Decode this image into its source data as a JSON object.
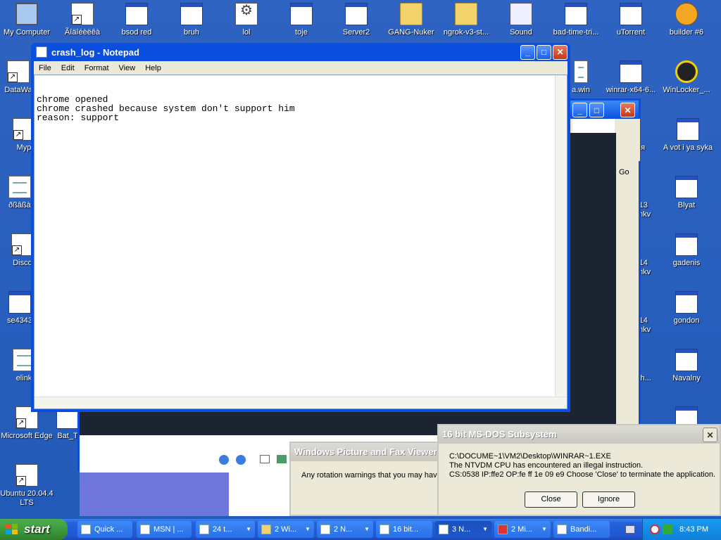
{
  "desktop_icons": [
    {
      "label": "My Computer",
      "icon": "computer-icon"
    },
    {
      "label": "Ãîäîéèëêà",
      "icon": "program-icon"
    },
    {
      "label": "bsod red",
      "icon": "window-icon"
    },
    {
      "label": "bruh",
      "icon": "window-icon"
    },
    {
      "label": "lol",
      "icon": "batch-icon"
    },
    {
      "label": "toje",
      "icon": "window-icon"
    },
    {
      "label": "Server2",
      "icon": "window-icon"
    },
    {
      "label": "GANG-Nuker",
      "icon": "zip-folder-icon"
    },
    {
      "label": "ngrok-v3-st...",
      "icon": "zip-folder-icon"
    },
    {
      "label": "Sound",
      "icon": "wav-icon"
    },
    {
      "label": "bad-time-tri...",
      "icon": "window-icon"
    },
    {
      "label": "uTorrent",
      "icon": "window-icon"
    },
    {
      "label": "builder #6",
      "icon": "skull-icon"
    },
    {
      "label": "DataWa",
      "icon": "shortcut-icon"
    },
    {
      "label": "Myp",
      "icon": "shortcut-icon"
    },
    {
      "label": "ðßâßà",
      "icon": "doc-icon"
    },
    {
      "label": "Disco",
      "icon": "shortcut-icon"
    },
    {
      "label": "se4343",
      "icon": "window-icon"
    },
    {
      "label": "elink",
      "icon": "doc-icon"
    },
    {
      "label": "Microsoft Edge",
      "icon": "shortcut-icon"
    },
    {
      "label": "Bat_T",
      "icon": "window-icon"
    },
    {
      "label": "Ubuntu 20.04.4 LTS",
      "icon": "shortcut-icon"
    },
    {
      "label": "winrar-x64-6...",
      "icon": "window-icon"
    },
    {
      "label": "WinLocker_...",
      "icon": "radiation-icon"
    },
    {
      "label": "A vot i ya syka",
      "icon": "window-icon"
    },
    {
      "label": "Blyat",
      "icon": "window-icon"
    },
    {
      "label": "gadenis",
      "icon": "window-icon"
    },
    {
      "label": "gondon",
      "icon": "window-icon"
    },
    {
      "label": "Navalny",
      "icon": "window-icon"
    },
    {
      "label": "a.win",
      "icon": "window-icon"
    },
    {
      "label": "-13 mkv",
      "icon": "window-icon"
    },
    {
      "label": "-14 mkv",
      "icon": "window-icon"
    },
    {
      "label": "-14 mkv",
      "icon": "window-icon"
    },
    {
      "label": "sh...",
      "icon": "window-icon"
    },
    {
      "label": "ня",
      "icon": "window-icon"
    },
    {
      "label": "Go",
      "icon": "window-icon"
    }
  ],
  "notepad": {
    "title": "crash_log - Notepad",
    "menu": [
      "File",
      "Edit",
      "Format",
      "View",
      "Help"
    ],
    "content": "chrome opened\nchrome crashed because system don't support him\nreason: support"
  },
  "fax_viewer": {
    "title": "Windows Picture and Fax Viewer",
    "message": "Any rotation warnings that you may hav"
  },
  "msdos_dialog": {
    "title": "16 bit MS-DOS Subsystem",
    "line1": "C:\\DOCUME~1\\VM2\\Desktop\\WINRAR~1.EXE",
    "line2": "The NTVDM CPU has encountered an illegal instruction.",
    "line3": "CS:0538 IP:ffe2 OP:fe ff 1e 09 e9 Choose 'Close' to terminate the application.",
    "close_label": "Close",
    "ignore_label": "Ignore"
  },
  "taskbar": {
    "start_label": "start",
    "items": [
      {
        "label": "Quick ..."
      },
      {
        "label": "MSN | ..."
      },
      {
        "label": "24 t..."
      },
      {
        "label": "2 Wi..."
      },
      {
        "label": "2 N..."
      },
      {
        "label": "16 bit..."
      },
      {
        "label": "3 N..."
      },
      {
        "label": "2 Mi..."
      },
      {
        "label": "Bandi..."
      }
    ],
    "clock": "8:43 PM"
  }
}
